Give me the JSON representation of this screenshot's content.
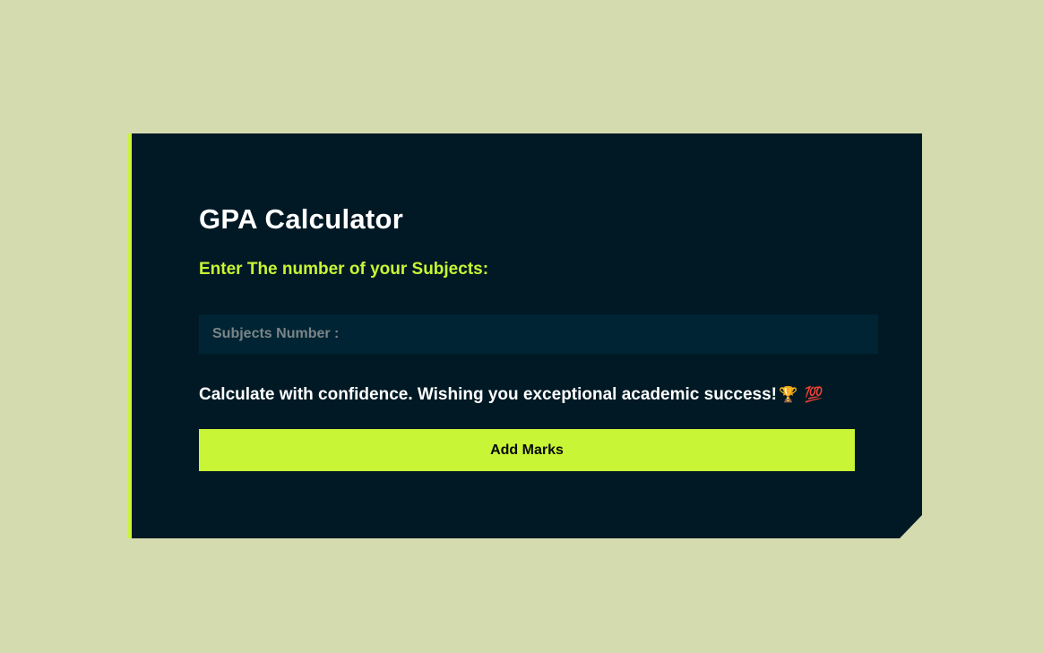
{
  "card": {
    "title": "GPA Calculator",
    "subtitle": "Enter The number of your Subjects:",
    "subjects_input": {
      "placeholder": "Subjects Number :",
      "value": ""
    },
    "message": "Calculate with confidence. Wishing you exceptional academic success!",
    "emojis": {
      "trophy": "🏆",
      "hundred": "💯"
    },
    "add_button_label": "Add Marks"
  },
  "colors": {
    "background": "#d4dbae",
    "card": "#001924",
    "accent": "#c8f535",
    "input_background": "#002433",
    "text": "#ffffff"
  }
}
